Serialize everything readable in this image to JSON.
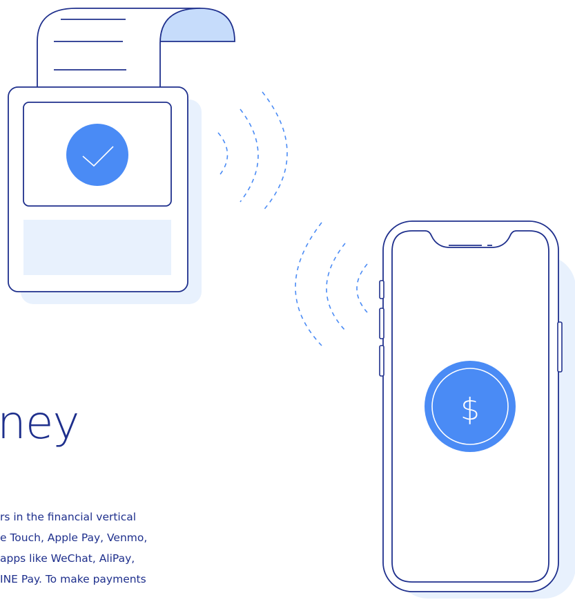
{
  "hero": {
    "title": "ney",
    "body_lines": [
      "rs in the financial vertical",
      "e Touch, Apple Pay, Venmo,",
      "apps like WeChat, AliPay,",
      "INE Pay. To make payments"
    ]
  },
  "phone": {
    "currency_symbol": "$"
  },
  "colors": {
    "navy": "#1E2F8C",
    "accent_blue": "#4A8BF5",
    "shadow_blue": "#E8F1FD",
    "roll_blue": "#C6DCFB",
    "dash_blue": "#4A8BF5"
  },
  "icons": [
    "receipt-roll-icon",
    "checkmark-icon",
    "nfc-waves-icon",
    "smartphone-icon",
    "dollar-coin-icon"
  ]
}
